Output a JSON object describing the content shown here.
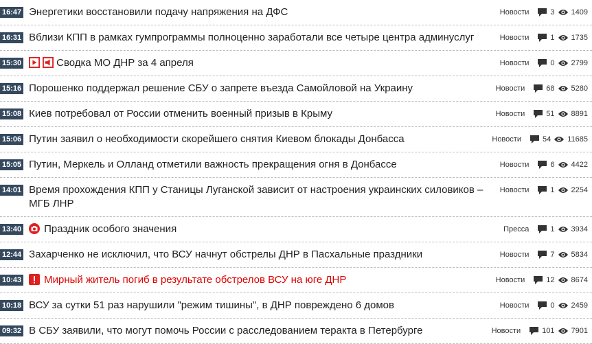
{
  "news": [
    {
      "time": "16:47",
      "title": "Энергетики восстановили подачу напряжения на ДФС",
      "category": "Новости",
      "comments": "3",
      "views": "1409",
      "alert": false,
      "badges": []
    },
    {
      "time": "16:31",
      "title": "Вблизи КПП в рамках гумпрограммы полноценно заработали все четыре центра админуслуг",
      "category": "Новости",
      "comments": "1",
      "views": "1735",
      "alert": false,
      "badges": []
    },
    {
      "time": "15:30",
      "title": "Сводка МО ДНР за 4 апреля",
      "category": "Новости",
      "comments": "0",
      "views": "2799",
      "alert": false,
      "badges": [
        "video",
        "speaker"
      ]
    },
    {
      "time": "15:16",
      "title": "Порошенко поддержал решение СБУ о запрете въезда Самойловой на Украину",
      "category": "Новости",
      "comments": "68",
      "views": "5280",
      "alert": false,
      "badges": []
    },
    {
      "time": "15:08",
      "title": "Киев потребовал от России отменить военный призыв в Крыму",
      "category": "Новости",
      "comments": "51",
      "views": "8891",
      "alert": false,
      "badges": []
    },
    {
      "time": "15:06",
      "title": "Путин заявил о необходимости скорейшего снятия Киевом блокады Донбасса",
      "category": "Новости",
      "comments": "54",
      "views": "11685",
      "alert": false,
      "badges": []
    },
    {
      "time": "15:05",
      "title": "Путин, Меркель и Олланд отметили важность прекращения огня в Донбассе",
      "category": "Новости",
      "comments": "6",
      "views": "4422",
      "alert": false,
      "badges": []
    },
    {
      "time": "14:01",
      "title": "Время прохождения КПП у Станицы Луганской зависит от настроения украинских силовиков – МГБ ЛНР",
      "category": "Новости",
      "comments": "1",
      "views": "2254",
      "alert": false,
      "badges": []
    },
    {
      "time": "13:40",
      "title": "Праздник особого значения",
      "category": "Пресса",
      "comments": "1",
      "views": "3934",
      "alert": false,
      "badges": [
        "camera"
      ]
    },
    {
      "time": "12:44",
      "title": "Захарченко не исключил, что ВСУ начнут обстрелы ДНР в Пасхальные праздники",
      "category": "Новости",
      "comments": "7",
      "views": "5834",
      "alert": false,
      "badges": []
    },
    {
      "time": "10:43",
      "title": "Мирный житель погиб в результате обстрелов ВСУ на юге ДНР",
      "category": "Новости",
      "comments": "12",
      "views": "8674",
      "alert": true,
      "badges": [
        "exclamation"
      ]
    },
    {
      "time": "10:18",
      "title": "ВСУ за сутки 51 раз нарушили \"режим тишины\", в ДНР повреждено 6 домов",
      "category": "Новости",
      "comments": "0",
      "views": "2459",
      "alert": false,
      "badges": []
    },
    {
      "time": "09:32",
      "title": "В СБУ заявили, что могут помочь России с расследованием теракта в Петербурге",
      "category": "Новости",
      "comments": "101",
      "views": "7901",
      "alert": false,
      "badges": []
    }
  ],
  "colors": {
    "time_badge": "#34495e",
    "alert": "#e00000",
    "icon_red": "#e02020"
  }
}
